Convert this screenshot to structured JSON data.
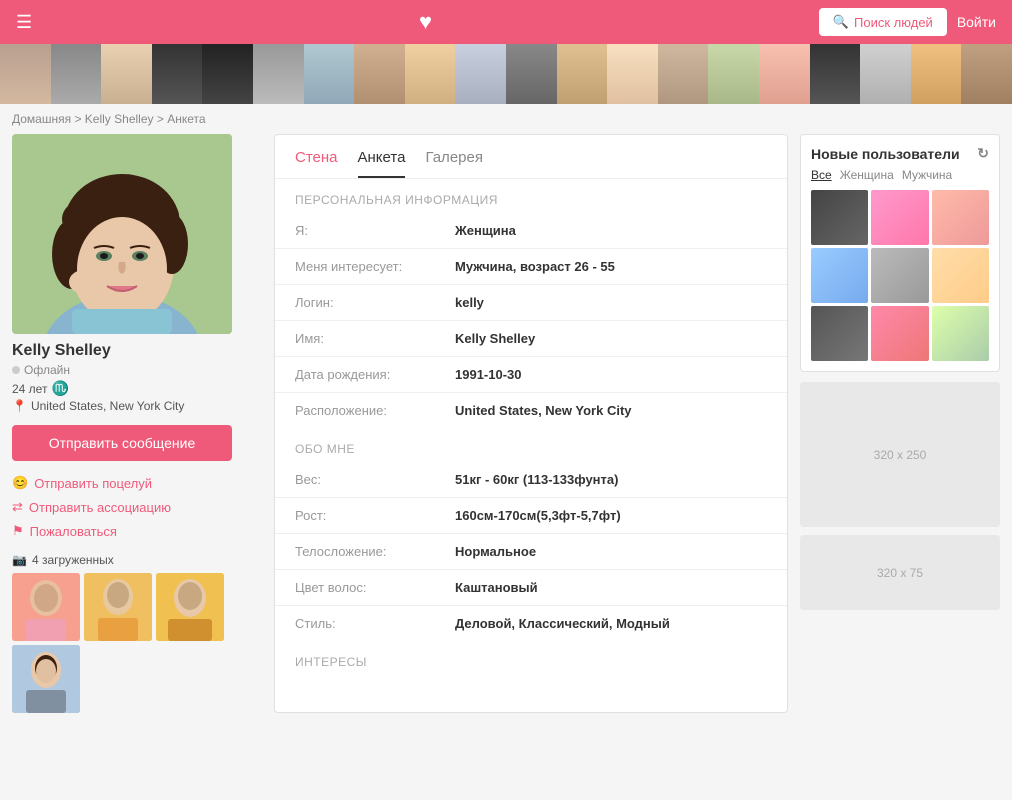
{
  "header": {
    "menu_icon": "☰",
    "heart_icon": "♥",
    "search_label": "Поиск людей",
    "login_label": "Войти"
  },
  "breadcrumb": {
    "home": "Домашняя",
    "separator1": " > ",
    "user": "Kelly Shelley",
    "separator2": " > ",
    "page": "Анкета"
  },
  "tabs": [
    {
      "label": "Стена",
      "id": "wall"
    },
    {
      "label": "Анкета",
      "id": "profile",
      "active": true
    },
    {
      "label": "Галерея",
      "id": "gallery"
    }
  ],
  "profile": {
    "name": "Kelly Shelley",
    "status": "Офлайн",
    "age": "24 лет",
    "zodiac": "♏",
    "location": "United States, New York City",
    "message_btn": "Отправить сообщение",
    "action_kiss": "Отправить поцелуй",
    "action_assoc": "Отправить ассоциацию",
    "action_report": "Пожаловаться",
    "uploads_label": "4 загруженных"
  },
  "personal_info": {
    "section_title": "ПЕРСОНАЛЬНАЯ ИНФОРМАЦИЯ",
    "fields": [
      {
        "label": "Я:",
        "value": "Женщина"
      },
      {
        "label": "Меня интересует:",
        "value": "Мужчина, возраст 26 - 55"
      },
      {
        "label": "Логин:",
        "value": "kelly"
      },
      {
        "label": "Имя:",
        "value": "Kelly Shelley"
      },
      {
        "label": "Дата рождения:",
        "value": "1991-10-30"
      },
      {
        "label": "Расположение:",
        "value": "United States, New York City"
      }
    ]
  },
  "about_me": {
    "section_title": "ОБО МНЕ",
    "fields": [
      {
        "label": "Вес:",
        "value": "51кг - 60кг (113-133фунта)"
      },
      {
        "label": "Рост:",
        "value": "160см-170см(5,3фт-5,7фт)"
      },
      {
        "label": "Телосложение:",
        "value": "Нормальное"
      },
      {
        "label": "Цвет волос:",
        "value": "Каштановый"
      },
      {
        "label": "Стиль:",
        "value": "Деловой, Классический, Модный"
      }
    ]
  },
  "interests": {
    "section_title": "ИНТЕРЕСЫ"
  },
  "new_users": {
    "title": "Новые пользователи",
    "filter_all": "Все",
    "filter_female": "Женщина",
    "filter_male": "Мужчина"
  },
  "ads": {
    "large": "320 x 250",
    "small": "320 x 75"
  },
  "strip_faces": [
    "sf1",
    "sf2",
    "sf3",
    "sf4",
    "sf5",
    "sf6",
    "sf7",
    "sf8",
    "sf9",
    "sf10",
    "sf11",
    "sf12",
    "sf13",
    "sf14",
    "sf15",
    "sf16",
    "sf17",
    "sf18",
    "sf19",
    "sf20"
  ]
}
